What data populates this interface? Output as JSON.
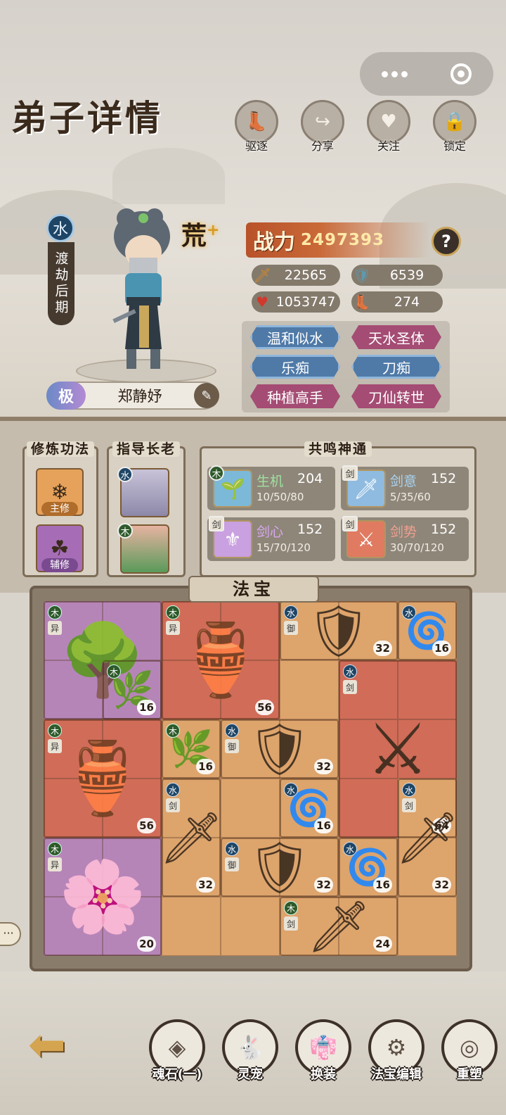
{
  "header": {
    "title": "弟子详情"
  },
  "actions": [
    {
      "label": "驱逐",
      "icon": "boot-icon",
      "glyph": "👢"
    },
    {
      "label": "分享",
      "icon": "share-arrow-icon",
      "glyph": "↪"
    },
    {
      "label": "关注",
      "icon": "heart-icon",
      "glyph": "♥"
    },
    {
      "label": "锁定",
      "icon": "lock-icon",
      "glyph": "🔒"
    }
  ],
  "character": {
    "element": "水",
    "realm": "渡劫后期",
    "grade": "荒",
    "grade_plus": "+",
    "rank": "极",
    "name": "郑静妤"
  },
  "power": {
    "label": "战力",
    "value": "2497393",
    "help": "?"
  },
  "stats": [
    {
      "name": "attack",
      "icon": "sword-hilt-icon",
      "glyph": "🗡",
      "value": "22565",
      "color": "#c98a3a"
    },
    {
      "name": "defense",
      "icon": "shield-icon",
      "glyph": "🛡",
      "value": "6539",
      "color": "#4b7a8c"
    },
    {
      "name": "hp",
      "icon": "heart-icon",
      "glyph": "♥",
      "value": "1053747",
      "color": "#c0392b"
    },
    {
      "name": "speed",
      "icon": "boot-icon",
      "glyph": "👢",
      "value": "274",
      "color": "#3a8a3a"
    }
  ],
  "traits": [
    {
      "label": "温和似水",
      "style": "blue"
    },
    {
      "label": "天水圣体",
      "style": "pink"
    },
    {
      "label": "乐痴",
      "style": "blue"
    },
    {
      "label": "刀痴",
      "style": "blue"
    },
    {
      "label": "种植高手",
      "style": "pink"
    },
    {
      "label": "刀仙转世",
      "style": "pink"
    }
  ],
  "cultivation": {
    "title": "修炼功法",
    "main_tag": "主修",
    "aux_tag": "辅修"
  },
  "elders": {
    "title": "指导长老",
    "elder1_element": "水",
    "elder2_element": "木"
  },
  "resonance": {
    "title": "共鸣神通",
    "items": [
      {
        "name": "生机",
        "level": "204",
        "stages": "10/50/80",
        "element": "木",
        "name_color": "#9fe0a0"
      },
      {
        "name": "剑意",
        "level": "152",
        "stages": "5/35/60",
        "element": "剑",
        "name_color": "#a8d4f4"
      },
      {
        "name": "剑心",
        "level": "152",
        "stages": "15/70/120",
        "element": "剑",
        "name_color": "#d9a8f0"
      },
      {
        "name": "剑势",
        "level": "152",
        "stages": "30/70/120",
        "element": "剑",
        "name_color": "#f0a090"
      }
    ]
  },
  "treasure": {
    "title": "法宝",
    "items": [
      {
        "tags": [
          "木",
          "异"
        ],
        "count": "16",
        "glyph": "🌳",
        "icon": "bonsai-tree-icon"
      },
      {
        "tags": [
          "木",
          "异"
        ],
        "count": "56",
        "glyph": "🏺",
        "icon": "jade-vase-icon"
      },
      {
        "tags": [
          "水",
          "御"
        ],
        "count": "32",
        "glyph": "🛡",
        "icon": "ice-armor-icon"
      },
      {
        "tags": [
          "水"
        ],
        "count": "16",
        "glyph": "🌀",
        "icon": "water-orb-icon"
      },
      {
        "tags": [
          "木"
        ],
        "count": "16",
        "glyph": "🌿",
        "icon": "vine-ring-icon"
      },
      {
        "tags": [
          "水",
          "剑"
        ],
        "count": "64",
        "glyph": "⚔",
        "icon": "ice-sword-icon"
      },
      {
        "tags": [
          "木",
          "异"
        ],
        "count": "56",
        "glyph": "🏺",
        "icon": "jade-vase-icon"
      },
      {
        "tags": [
          "木"
        ],
        "count": "16",
        "glyph": "🌿",
        "icon": "vine-ring-icon"
      },
      {
        "tags": [
          "水",
          "御"
        ],
        "count": "32",
        "glyph": "🛡",
        "icon": "ice-armor-icon"
      },
      {
        "tags": [
          "水"
        ],
        "count": "16",
        "glyph": "🌀",
        "icon": "water-orb-icon"
      },
      {
        "tags": [
          "水",
          "剑"
        ],
        "count": "32",
        "glyph": "🗡",
        "icon": "ice-blade-icon"
      },
      {
        "tags": [
          "水",
          "剑"
        ],
        "count": "32",
        "glyph": "🗡",
        "icon": "ice-blade-icon"
      },
      {
        "tags": [
          "木",
          "异"
        ],
        "count": "20",
        "glyph": "🌸",
        "icon": "purple-flower-icon"
      },
      {
        "tags": [
          "水",
          "御"
        ],
        "count": "32",
        "glyph": "🛡",
        "icon": "ice-armor-icon"
      },
      {
        "tags": [
          "水"
        ],
        "count": "16",
        "glyph": "🌀",
        "icon": "water-orb-icon"
      },
      {
        "tags": [
          "木",
          "剑"
        ],
        "count": "24",
        "glyph": "🗡",
        "icon": "wood-sword-icon"
      }
    ]
  },
  "bottom_nav": [
    {
      "label": "魂石(一)",
      "icon": "soul-stone-icon",
      "glyph": "◈"
    },
    {
      "label": "灵宠",
      "icon": "rabbit-icon",
      "glyph": "🐇"
    },
    {
      "label": "换装",
      "icon": "outfit-icon",
      "glyph": "👘"
    },
    {
      "label": "法宝编辑",
      "icon": "treasure-edit-icon",
      "glyph": "⚙"
    },
    {
      "label": "重塑",
      "icon": "swirl-icon",
      "glyph": "◎"
    }
  ],
  "back": {
    "icon": "back-arrow-icon",
    "glyph": "⬅"
  },
  "chat": {
    "glyph": "···"
  }
}
